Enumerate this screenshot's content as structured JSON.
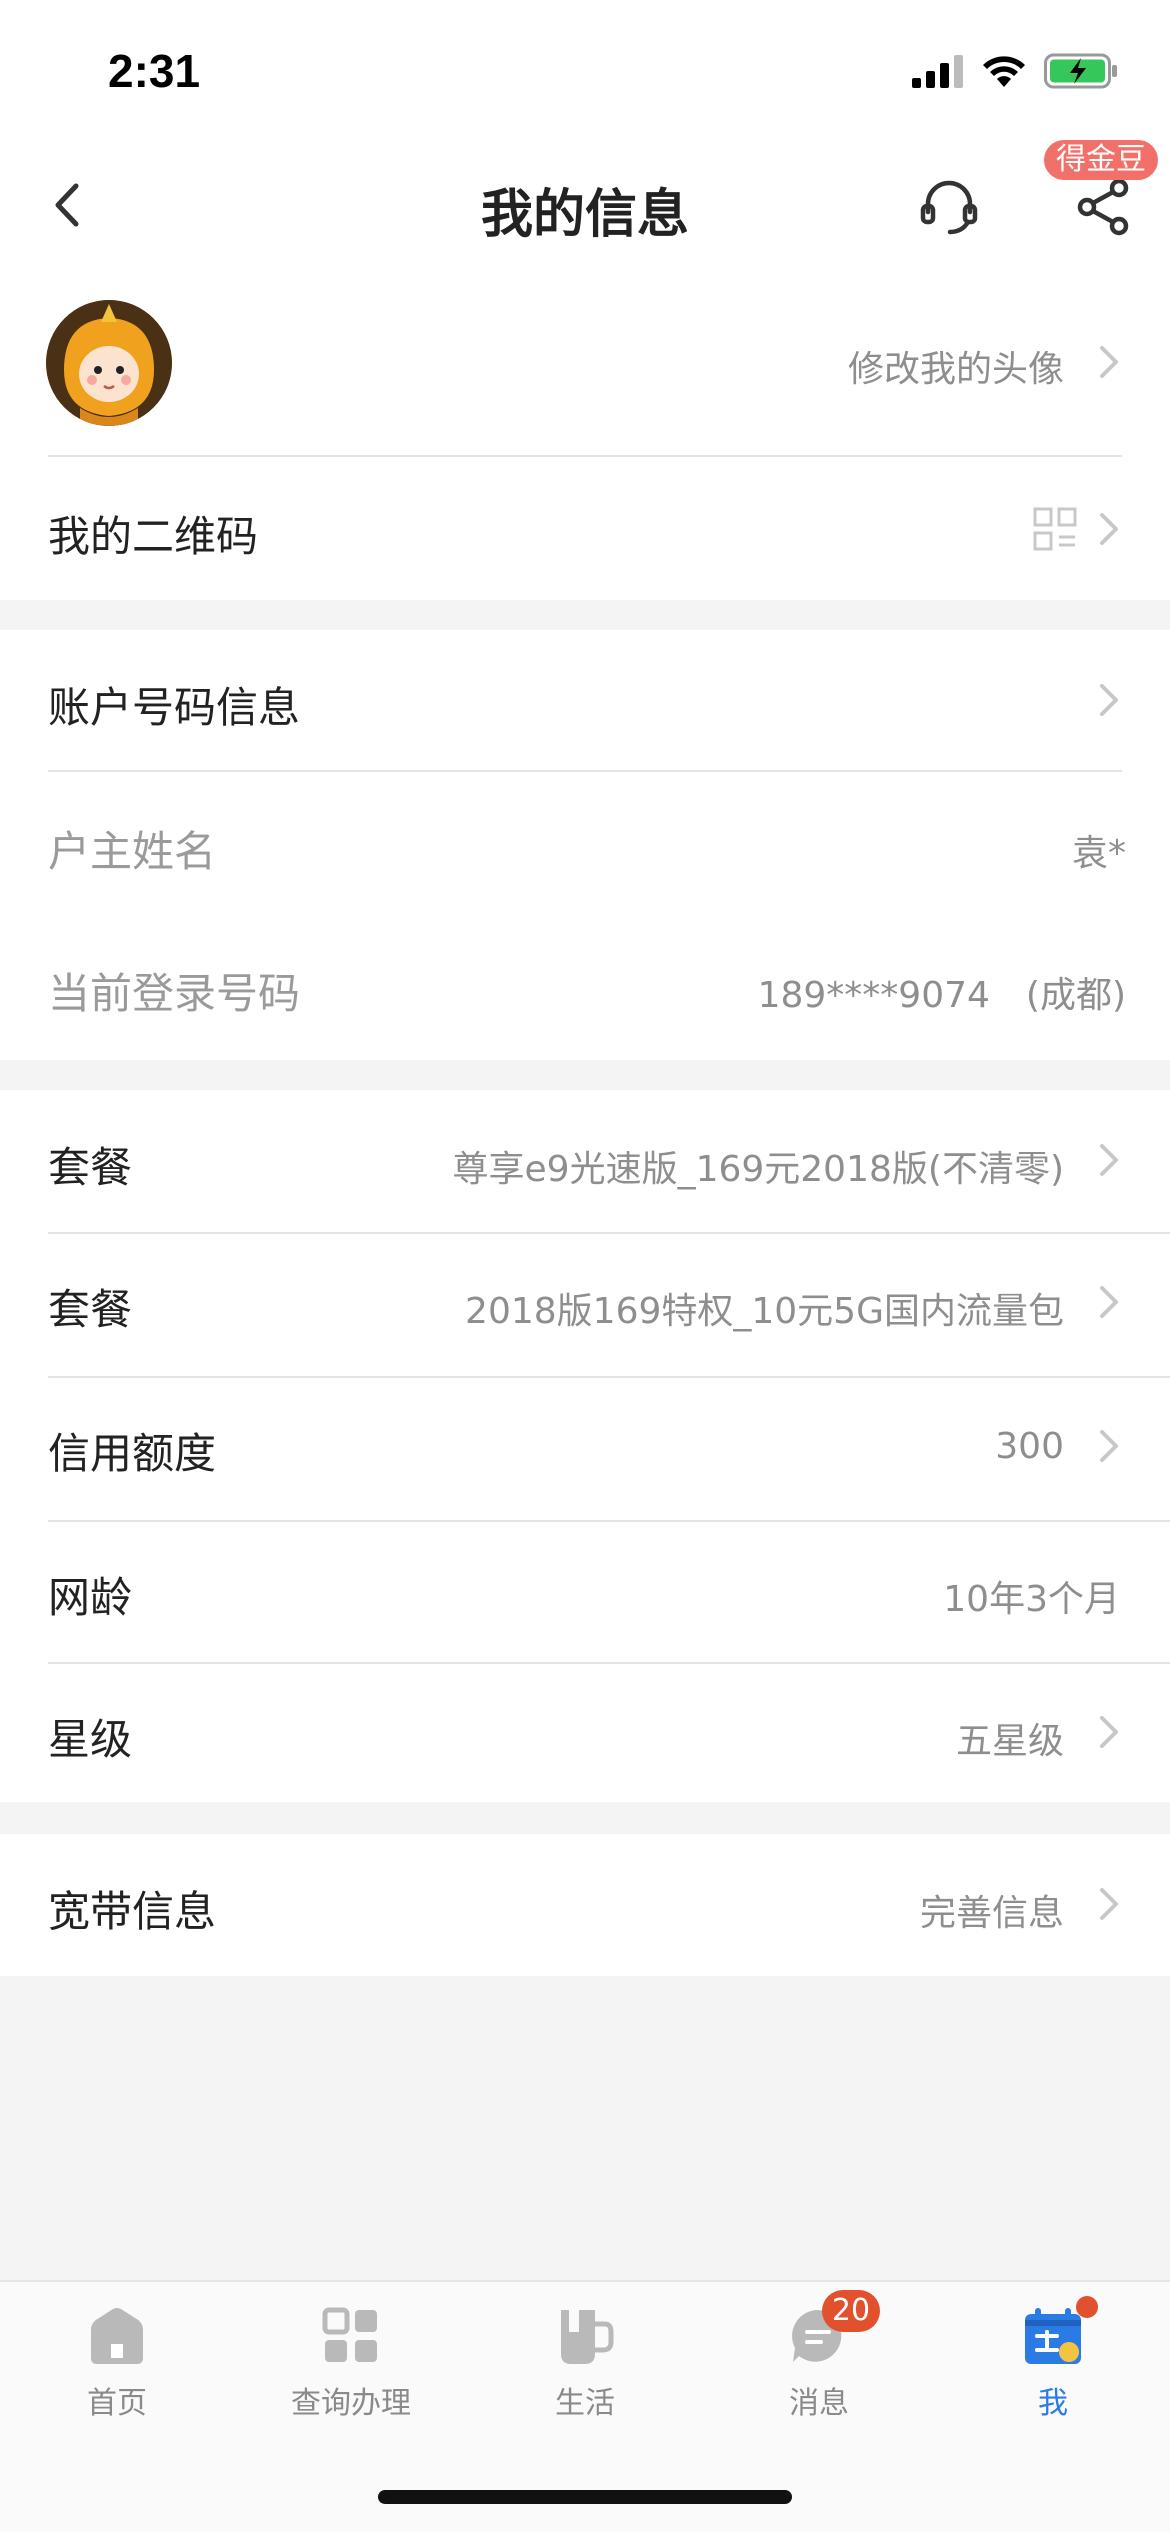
{
  "status_bar": {
    "time": "2:31"
  },
  "nav": {
    "title": "我的信息",
    "bean_badge": "得金豆"
  },
  "profile": {
    "change_avatar_label": "修改我的头像",
    "qr_label": "我的二维码"
  },
  "account": {
    "header_label": "账户号码信息",
    "owner_label": "户主姓名",
    "owner_value": "袁*",
    "login_label": "当前登录号码",
    "login_value": "189****9074　(成都)"
  },
  "plans": [
    {
      "label": "套餐",
      "value": "尊享e9光速版_169元2018版(不清零)"
    },
    {
      "label": "套餐",
      "value": "2018版169特权_10元5G国内流量包"
    }
  ],
  "credit": {
    "label": "信用额度",
    "value": "300"
  },
  "tenure": {
    "label": "网龄",
    "value": "10年3个月"
  },
  "star": {
    "label": "星级",
    "value": "五星级"
  },
  "broadband": {
    "label": "宽带信息",
    "value": "完善信息"
  },
  "tabs": [
    {
      "label": "首页",
      "icon": "home-icon"
    },
    {
      "label": "查询办理",
      "icon": "grid-icon"
    },
    {
      "label": "生活",
      "icon": "cup-icon"
    },
    {
      "label": "消息",
      "icon": "message-icon",
      "badge": "20"
    },
    {
      "label": "我",
      "icon": "sign-calendar-icon",
      "active": true
    }
  ],
  "colors": {
    "accent": "#2b7be4",
    "badge": "#e2512e",
    "bean": "#f2706a"
  }
}
